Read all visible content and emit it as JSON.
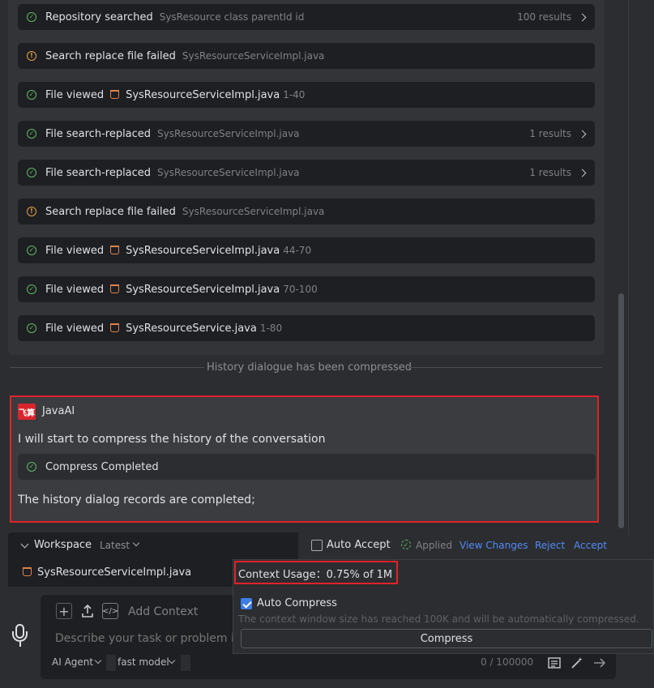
{
  "tool_rows": [
    {
      "status": "ok",
      "title": "Repository searched",
      "sub": "SysResource class parentId id",
      "right": "100 results",
      "chevron": true
    },
    {
      "status": "warn",
      "title": "Search replace file failed",
      "sub": "SysResourceServiceImpl.java"
    },
    {
      "status": "ok",
      "title": "File viewed",
      "file": "SysResourceServiceImpl.java",
      "range": "1-40"
    },
    {
      "status": "ok",
      "title": "File search-replaced",
      "sub": "SysResourceServiceImpl.java",
      "right": "1 results",
      "chevron": true
    },
    {
      "status": "ok",
      "title": "File search-replaced",
      "sub": "SysResourceServiceImpl.java",
      "right": "1 results",
      "chevron": true
    },
    {
      "status": "warn",
      "title": "Search replace file failed",
      "sub": "SysResourceServiceImpl.java"
    },
    {
      "status": "ok",
      "title": "File viewed",
      "file": "SysResourceServiceImpl.java",
      "range": "44-70"
    },
    {
      "status": "ok",
      "title": "File viewed",
      "file": "SysResourceServiceImpl.java",
      "range": "70-100"
    },
    {
      "status": "ok",
      "title": "File viewed",
      "file": "SysResourceService.java",
      "range": "1-80"
    }
  ],
  "divider_text": "History dialogue has been compressed",
  "message": {
    "avatar_text": "飞算",
    "sender": "JavaAI",
    "intro": "I will start to compress the history of the conversation",
    "step": "Compress Completed",
    "result": "The history dialog records are completed;"
  },
  "workspace": {
    "title": "Workspace",
    "version": "Latest",
    "auto_accept": "Auto Accept",
    "applied": "Applied",
    "view_changes": "View Changes",
    "reject": "Reject",
    "accept": "Accept",
    "file": "SysResourceServiceImpl.java"
  },
  "popup": {
    "context_usage": "Context Usage：0.75% of 1M",
    "auto_compress": "Auto Compress",
    "auto_compress_checked": true,
    "hint": "The context window size has reached 100K and will be automatically compressed.",
    "compress_button": "Compress"
  },
  "input": {
    "add_context": "Add Context",
    "placeholder": "Describe your task or problem in",
    "mode": "AI Agent",
    "model": "fast model",
    "counter": "0 / 100000"
  },
  "colors": {
    "ok": "#5fb865",
    "warn": "#e0a247",
    "highlight": "#e0222b",
    "link": "#548af7"
  }
}
